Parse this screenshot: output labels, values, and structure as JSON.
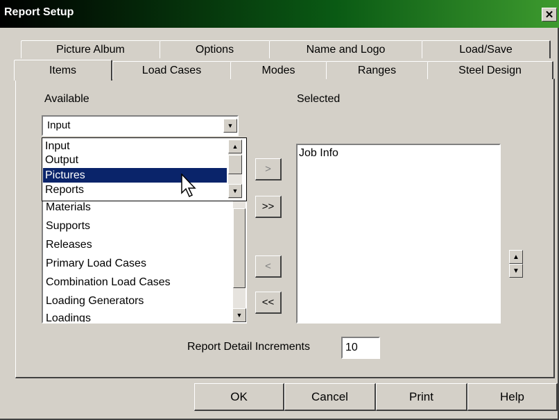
{
  "window": {
    "title": "Report Setup",
    "close_glyph": "✕"
  },
  "tabs_back": [
    "Picture Album",
    "Options",
    "Name and Logo",
    "Load/Save"
  ],
  "tabs_front": [
    "Items",
    "Load Cases",
    "Modes",
    "Ranges",
    "Steel Design"
  ],
  "active_tab": "Items",
  "available": {
    "label": "Available",
    "combo_value": "Input",
    "dropdown_options": [
      "Input",
      "Output",
      "Pictures",
      "Reports"
    ],
    "dropdown_selected": "Pictures",
    "items": [
      "Materials",
      "Supports",
      "Releases",
      "Primary Load Cases",
      "Combination Load Cases",
      "Loading Generators",
      "Loadings"
    ]
  },
  "selected": {
    "label": "Selected",
    "items": [
      "Job Info"
    ]
  },
  "move_buttons": {
    "add": ">",
    "add_all": ">>",
    "remove": "<",
    "remove_all": "<<"
  },
  "order_buttons": {
    "up": "▲",
    "down": "▼"
  },
  "increments": {
    "label": "Report Detail Increments",
    "value": "10"
  },
  "buttons": {
    "ok": "OK",
    "cancel": "Cancel",
    "print": "Print",
    "help": "Help"
  },
  "colors": {
    "highlight": "#0a246a",
    "title_start": "#000000",
    "title_end": "#3d9a2e",
    "face": "#d4d0c8"
  }
}
